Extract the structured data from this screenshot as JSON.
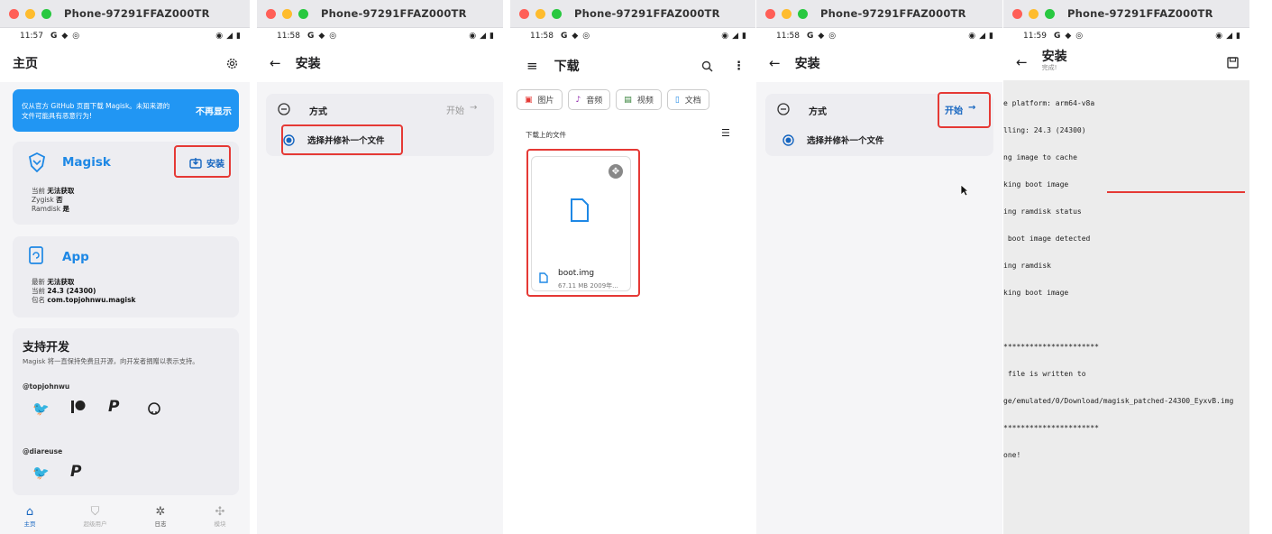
{
  "window_title": "Phone-97291FFAZ000TR",
  "status_icons": [
    "G",
    "◆",
    "◎"
  ],
  "panel1": {
    "time": "11:57",
    "title": "主页",
    "banner_text": "仅从官方 GitHub 页面下载 Magisk。未知来源的文件可能具有恶意行为!",
    "banner_action": "不再显示",
    "magisk": {
      "name": "Magisk",
      "install_label": "安装",
      "rows": [
        {
          "k": "当前",
          "v": "无法获取"
        },
        {
          "k": "Zygisk",
          "v": "否"
        },
        {
          "k": "Ramdisk",
          "v": "是"
        }
      ]
    },
    "app": {
      "name": "App",
      "rows": [
        {
          "k": "最新",
          "v": "无法获取"
        },
        {
          "k": "当前",
          "v": "24.3 (24300)"
        },
        {
          "k": "包名",
          "v": "com.topjohnwu.magisk"
        }
      ]
    },
    "support": {
      "title": "支持开发",
      "desc": "Magisk 将一直保持免费且开源，向开发者捐赠以表示支持。",
      "dev1": "@topjohnwu",
      "dev2": "@diareuse"
    },
    "nav": [
      "主页",
      "超级用户",
      "日志",
      "模块"
    ]
  },
  "panel2": {
    "time": "11:58",
    "title": "安装",
    "method_label": "方式",
    "start_label": "开始",
    "option": "选择并修补一个文件"
  },
  "panel3": {
    "time": "11:58",
    "title": "下载",
    "chips": [
      "图片",
      "音频",
      "视频",
      "文档"
    ],
    "section": "下载上的文件",
    "file_name": "boot.img",
    "file_meta": "67.11 MB 2009年..."
  },
  "panel4": {
    "time": "11:58",
    "title": "安装",
    "method_label": "方式",
    "start_label": "开始",
    "option": "选择并修补一个文件"
  },
  "panel5": {
    "time": "11:59",
    "title": "安装",
    "subtitle": "完成!",
    "log": [
      "e platform: arm64-v8a",
      "lling: 24.3 (24300)",
      "ng image to cache",
      "king boot image",
      "ing ramdisk status",
      " boot image detected",
      "ing ramdisk",
      "king boot image",
      "",
      "**********************",
      " file is written to",
      "ge/emulated/0/Download/magisk_patched-24300_EyxvB.img",
      "**********************",
      "one!"
    ]
  },
  "colors": {
    "accent": "#1565c0",
    "highlight": "#e53935",
    "banner": "#2196f3"
  }
}
